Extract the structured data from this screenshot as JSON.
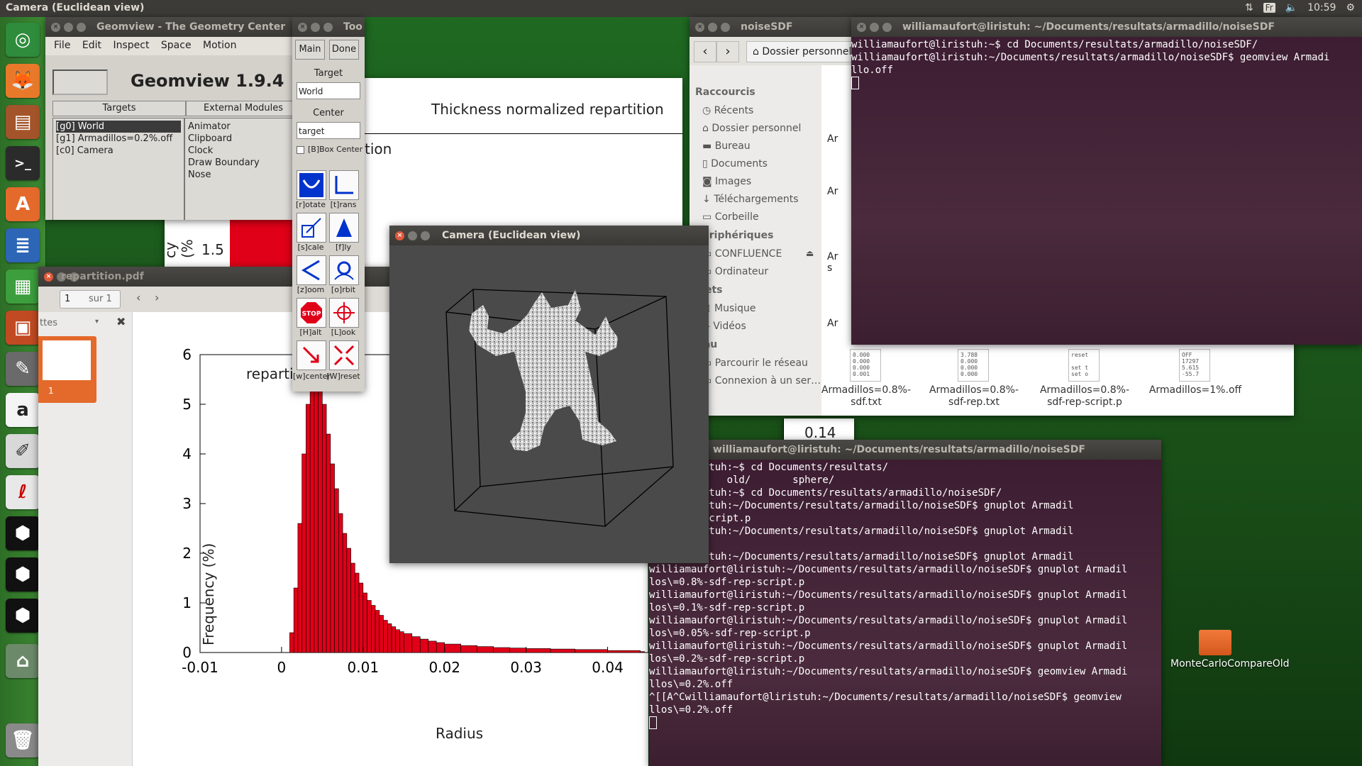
{
  "topbar": {
    "title": "Camera (Euclidean view)",
    "lang": "Fr",
    "time": "10:59"
  },
  "launcher": {
    "icons": [
      "ubuntu-icon",
      "firefox-icon",
      "files-icon",
      "terminal-icon",
      "software-center-icon",
      "writer-icon",
      "calc-icon",
      "impress-icon",
      "settings-icon",
      "amazon-icon",
      "text-editor-icon",
      "pdf-viewer-icon",
      "geomview-icon-1",
      "geomview-icon-2",
      "geomview-icon-3",
      "usb-icon",
      "trash-icon"
    ]
  },
  "geomview": {
    "title": "Geomview - The Geometry Center",
    "menu": [
      "File",
      "Edit",
      "Inspect",
      "Space",
      "Motion"
    ],
    "heading": "Geomview 1.9.4",
    "tabs": [
      "Targets",
      "External Modules"
    ],
    "targets": [
      "[g0] World",
      "[g1] Armadillos=0.2%.off",
      "[c0] Camera"
    ],
    "modules": [
      "Animator",
      "Clipboard",
      "Clock",
      "Draw Boundary",
      "Nose"
    ]
  },
  "tools": {
    "title": "Too",
    "main_label": "Main",
    "done_label": "Done",
    "target_label": "Target",
    "target_value": "World",
    "center_label": "Center",
    "center_value": "target",
    "bbox_label": "[B]Box Center",
    "buttons": [
      "[r]otate",
      "[t]rans",
      "[s]cale",
      "[f]ly",
      "[z]oom",
      "[o]rbit",
      "[H]alt",
      "[L]ook",
      "[w]center",
      "[W]reset"
    ]
  },
  "pdf": {
    "title": "repartition.pdf",
    "page_input": "1",
    "page_total": "sur 1",
    "sidebar_label": "ttes",
    "thumb_number": "1",
    "chart_title_partial": "repartitio",
    "overlay_title": "Thick"
  },
  "back_chart": {
    "title": "Thickness normalized repartition",
    "legend_partial": "tion",
    "ylabel_partial": "cy (%",
    "tick": "1.5",
    "tick2": "0.14"
  },
  "chart_data": {
    "type": "bar",
    "title": "repartitio",
    "xlabel": "Radius",
    "ylabel": "Frequency (%)",
    "xlim": [
      -0.01,
      0.045
    ],
    "ylim": [
      0,
      6
    ],
    "xticks": [
      "-0.01",
      "0",
      "0.01",
      "0.02",
      "0.03",
      "0.04"
    ],
    "yticks": [
      "0",
      "1",
      "2",
      "3",
      "4",
      "5",
      "6"
    ],
    "x": [
      0.001,
      0.0015,
      0.002,
      0.0025,
      0.003,
      0.0035,
      0.004,
      0.0045,
      0.005,
      0.0055,
      0.006,
      0.0065,
      0.007,
      0.0075,
      0.008,
      0.0085,
      0.009,
      0.0095,
      0.01,
      0.0105,
      0.011,
      0.0115,
      0.012,
      0.0125,
      0.013,
      0.0135,
      0.014,
      0.0145,
      0.015,
      0.016,
      0.017,
      0.018,
      0.019,
      0.02,
      0.022,
      0.024,
      0.026,
      0.028,
      0.03,
      0.033,
      0.036,
      0.04,
      0.044
    ],
    "values": [
      0.4,
      1.3,
      2.6,
      4.0,
      5.0,
      5.7,
      5.9,
      5.6,
      5.0,
      4.4,
      3.8,
      3.3,
      2.8,
      2.4,
      2.1,
      1.8,
      1.6,
      1.4,
      1.2,
      1.05,
      0.95,
      0.85,
      0.75,
      0.65,
      0.58,
      0.52,
      0.46,
      0.42,
      0.38,
      0.32,
      0.27,
      0.23,
      0.2,
      0.17,
      0.14,
      0.12,
      0.1,
      0.09,
      0.08,
      0.07,
      0.06,
      0.04,
      0.02
    ]
  },
  "camera": {
    "title": "Camera (Euclidean view)"
  },
  "files": {
    "title": "noiseSDF",
    "location": "Dossier personnel",
    "sections": [
      {
        "head": "Raccourcis",
        "items": [
          "Récents",
          "Dossier personnel",
          "Bureau",
          "Documents",
          "Images",
          "Téléchargements",
          "Corbeille"
        ]
      },
      {
        "head": "Périphériques",
        "items": [
          "CONFLUENCE",
          "Ordinateur"
        ]
      },
      {
        "head": "gnets",
        "items": [
          "Musique",
          "Vidéos"
        ]
      },
      {
        "head": "seau",
        "items": [
          "Parcourir le réseau",
          "Connexion à un ser…"
        ]
      }
    ],
    "partial_labels": [
      "Ar",
      "Ar",
      "Ar s",
      "Ar"
    ],
    "file_items": [
      {
        "name": "Armadillos=0.8%-sdf.txt",
        "preview": "0.000\n0.000\n0.000\n0.001"
      },
      {
        "name": "Armadillos=0.8%-sdf-rep.txt",
        "preview": "3.788\n0.000\n0.000\n0.000"
      },
      {
        "name": "Armadillos=0.8%-sdf-rep-script.p",
        "preview": "reset\n\nset t\nset o"
      },
      {
        "name": "Armadillos=1%.off",
        "preview": "OFF\n17297\n5.615\n-55.7"
      }
    ]
  },
  "terminal_top": {
    "title": "williamaufort@liristuh: ~/Documents/resultats/armadillo/noiseSDF",
    "lines": [
      "williamaufort@liristuh:~$ cd Documents/resultats/armadillo/noiseSDF/",
      "williamaufort@liristuh:~/Documents/resultats/armadillo/noiseSDF$ geomview Armadi",
      "llo.off"
    ]
  },
  "terminal_bottom": {
    "title": "williamaufort@liristuh: ~/Documents/resultats/armadillo/noiseSDF",
    "lines": [
      "fort@liristuh:~$ cd Documents/resultats/",
      "/ knot/      old/       sphere/",
      "fort@liristuh:~$ cd Documents/resultats/armadillo/noiseSDF/",
      "fort@liristuh:~/Documents/resultats/armadillo/noiseSDF$ gnuplot Armadil",
      "-sdf-rep-script.p",
      "fort@liristuh:~/Documents/resultats/armadillo/noiseSDF$ gnuplot Armadil",
      "p-script.p",
      "fort@liristuh:~/Documents/resultats/armadillo/noiseSDF$ gnuplot Armadil",
      "williamaufort@liristuh:~/Documents/resultats/armadillo/noiseSDF$ gnuplot Armadil",
      "los\\=0.8%-sdf-rep-script.p",
      "williamaufort@liristuh:~/Documents/resultats/armadillo/noiseSDF$ gnuplot Armadil",
      "los\\=0.1%-sdf-rep-script.p",
      "williamaufort@liristuh:~/Documents/resultats/armadillo/noiseSDF$ gnuplot Armadil",
      "los\\=0.05%-sdf-rep-script.p",
      "williamaufort@liristuh:~/Documents/resultats/armadillo/noiseSDF$ gnuplot Armadil",
      "los\\=0.2%-sdf-rep-script.p",
      "williamaufort@liristuh:~/Documents/resultats/armadillo/noiseSDF$ geomview Armadi",
      "llos\\=0.2%.off",
      "^[[A^Cwilliamaufort@liristuh:~/Documents/resultats/armadillo/noiseSDF$ geomview",
      "llos\\=0.2%.off"
    ]
  },
  "desktop_folder": {
    "label": "MonteCarloCompareOld"
  }
}
